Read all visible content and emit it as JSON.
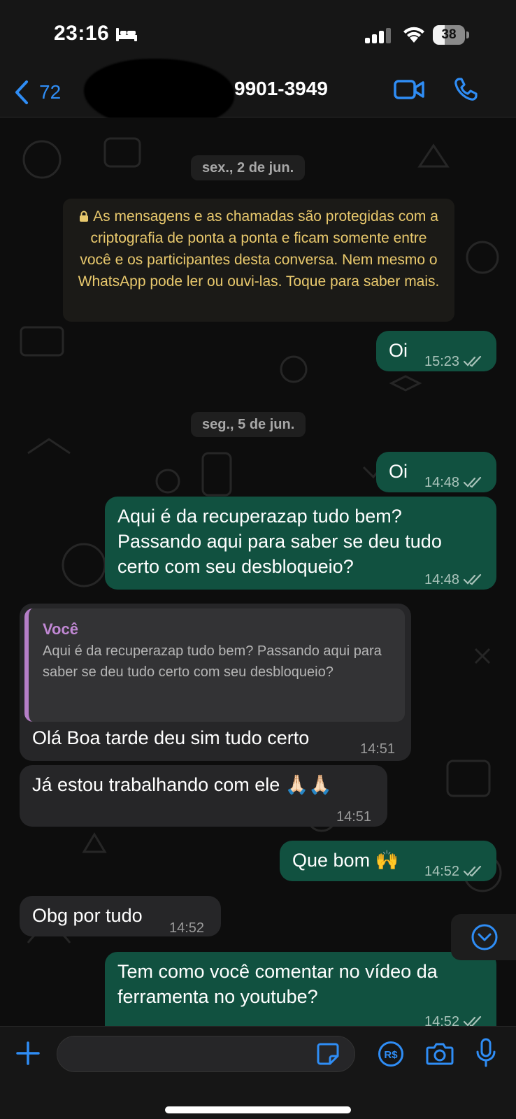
{
  "status_bar": {
    "time": "23:16",
    "battery": "38",
    "battery_level_percent": 38
  },
  "header": {
    "back_count": "72",
    "contact_name": "9901-3949"
  },
  "chat": {
    "date_1": "sex., 2 de jun.",
    "encryption_notice": "As mensagens e as chamadas são protegidas com a criptografia de ponta a ponta e ficam somente entre você e os participantes desta conversa. Nem mesmo o WhatsApp pode ler ou ouvi-las. Toque para saber mais.",
    "date_2": "seg., 5 de jun.",
    "messages": [
      {
        "direction": "outgoing",
        "text": "Oi",
        "time": "15:23",
        "status": "read"
      },
      {
        "direction": "outgoing",
        "text": "Oi",
        "time": "14:48",
        "status": "read"
      },
      {
        "direction": "outgoing",
        "text": "Aqui é da recuperazap tudo bem? Passando aqui para saber se deu tudo certo com seu desbloqueio?",
        "time": "14:48",
        "status": "read"
      },
      {
        "direction": "incoming",
        "quote_author": "Você",
        "quote_text": "Aqui é da recuperazap tudo bem? Passando aqui para saber se deu tudo certo com seu desbloqueio?",
        "text": "Olá Boa tarde deu sim tudo certo",
        "time": "14:51"
      },
      {
        "direction": "incoming",
        "text": "Já estou trabalhando com ele 🙏🏻🙏🏻",
        "time": "14:51"
      },
      {
        "direction": "outgoing",
        "text": "Que bom 🙌",
        "time": "14:52",
        "status": "read"
      },
      {
        "direction": "incoming",
        "text": "Obg por tudo",
        "time": "14:52"
      },
      {
        "direction": "outgoing",
        "text": "Tem como você comentar no vídeo da ferramenta no youtube?",
        "time": "14:52",
        "status": "read"
      }
    ]
  },
  "input": {
    "placeholder": "",
    "value": ""
  },
  "colors": {
    "outgoing_bubble": "#115140",
    "incoming_bubble": "#262628",
    "accent_blue": "#2f8df5",
    "notice_text": "#e9c96d",
    "quote_author": "#c188d4"
  },
  "icons": [
    "chevron-left-icon",
    "video-call-icon",
    "phone-icon",
    "lock-icon",
    "double-check-icon",
    "chevron-down-icon",
    "plus-icon",
    "sticker-icon",
    "pay-icon",
    "camera-icon",
    "microphone-icon",
    "bed-icon",
    "signal-icon",
    "wifi-icon",
    "battery-icon"
  ]
}
